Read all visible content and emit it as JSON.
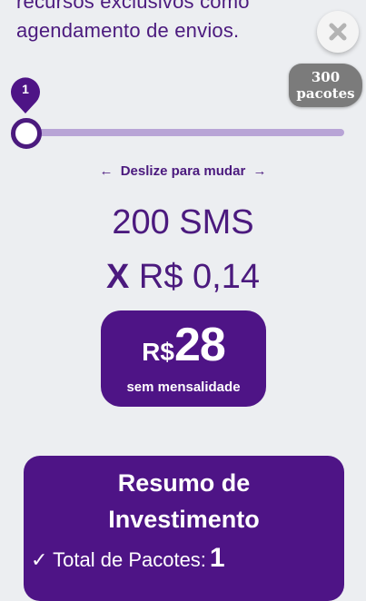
{
  "intro": {
    "line1": "recursos exclusivos como",
    "line2": "agendamento de envios."
  },
  "slider": {
    "current_label": "1",
    "max_label_line1": "300",
    "max_label_line2": "pacotes",
    "value": 1,
    "max": 300,
    "hint": "Deslize para mudar"
  },
  "quote": {
    "sms": "200 SMS",
    "x": "X",
    "unit_price": "R$ 0,14",
    "currency": "R$",
    "total": "28",
    "subtitle": "sem mensalidade"
  },
  "summary": {
    "title_line1": "Resumo de",
    "title_line2": "Investimento",
    "row_label": "✓ Total de Pacotes:",
    "row_value": "1"
  },
  "colors": {
    "primary": "#4e1486",
    "track": "#b8a4d6",
    "background": "#eceef1"
  },
  "icons": {
    "close": "close-icon",
    "left_arrow": "arrow-left-icon",
    "right_arrow": "arrow-right-icon"
  }
}
